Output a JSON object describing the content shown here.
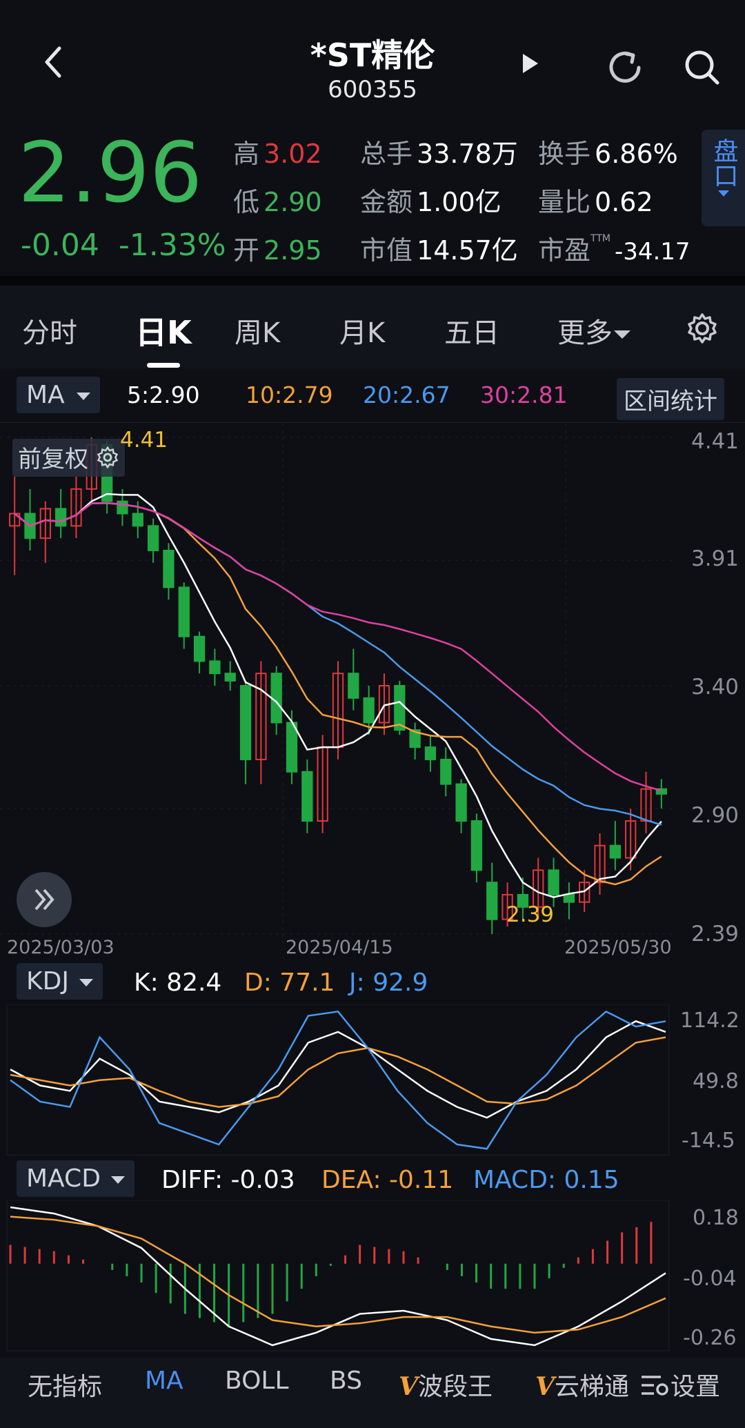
{
  "header": {
    "title": "*ST精伦",
    "code": "600355",
    "price": "2.96",
    "change": "-0.04",
    "change_pct": "-1.33%",
    "pankou": "盘口",
    "quote": {
      "high_label": "高",
      "high": "3.02",
      "low_label": "低",
      "low": "2.90",
      "open_label": "开",
      "open": "2.95",
      "volume_label": "总手",
      "volume": "33.78万",
      "amount_label": "金额",
      "amount": "1.00亿",
      "mktcap_label": "市值",
      "mktcap": "14.57亿",
      "turnover_label": "换手",
      "turnover": "6.86%",
      "volratio_label": "量比",
      "volratio": "0.62",
      "pe_label": "市盈",
      "pe_sup": "TTM",
      "pe": "-34.17"
    }
  },
  "tabs": [
    "分时",
    "日K",
    "周K",
    "月K",
    "五日",
    "更多"
  ],
  "active_tab": "日K",
  "ma": {
    "selector": "MA",
    "ma5": "5:2.90",
    "ma10": "10:2.79",
    "ma20": "20:2.67",
    "ma30": "30:2.81",
    "range_stats": "区间统计",
    "colors": {
      "ma5": "#ffffff",
      "ma10": "#f5a03a",
      "ma20": "#4a9af0",
      "ma30": "#e040a0"
    }
  },
  "main_chart": {
    "adjust_label": "前复权",
    "high_marker": "4.41",
    "low_marker": "2.39",
    "y_labels": [
      "4.41",
      "3.91",
      "3.40",
      "2.90",
      "2.39"
    ],
    "dates": [
      "2025/03/03",
      "2025/04/15",
      "2025/05/30"
    ]
  },
  "kdj": {
    "selector": "KDJ",
    "k": "K: 82.4",
    "d": "D: 77.1",
    "j": "J: 92.9",
    "y_labels": [
      "114.2",
      "49.8",
      "-14.5"
    ]
  },
  "macd": {
    "selector": "MACD",
    "diff": "DIFF: -0.03",
    "dea": "DEA: -0.11",
    "macd": "MACD: 0.15",
    "y_labels": [
      "0.18",
      "-0.04",
      "-0.26"
    ]
  },
  "bottom_nav": {
    "items": [
      "无指标",
      "MA",
      "BOLL",
      "BS",
      "波段王",
      "云梯通",
      "设置"
    ],
    "active": "MA",
    "v_mark": "V"
  },
  "chart_data": {
    "type": "candlestick",
    "title": "",
    "x": [
      "2025/03/03",
      "2025/04/15",
      "2025/05/30"
    ],
    "ylim": [
      2.39,
      4.41
    ],
    "candles_ohlc": [
      [
        4.05,
        4.25,
        3.85,
        4.1
      ],
      [
        4.1,
        4.2,
        3.95,
        4.0
      ],
      [
        4.0,
        4.15,
        3.9,
        4.12
      ],
      [
        4.12,
        4.2,
        4.0,
        4.05
      ],
      [
        4.05,
        4.25,
        4.0,
        4.2
      ],
      [
        4.2,
        4.41,
        4.15,
        4.38
      ],
      [
        4.38,
        4.4,
        4.1,
        4.15
      ],
      [
        4.15,
        4.2,
        4.05,
        4.1
      ],
      [
        4.1,
        4.15,
        4.0,
        4.05
      ],
      [
        4.05,
        4.08,
        3.9,
        3.95
      ],
      [
        3.95,
        3.98,
        3.75,
        3.8
      ],
      [
        3.8,
        3.82,
        3.55,
        3.6
      ],
      [
        3.6,
        3.62,
        3.45,
        3.5
      ],
      [
        3.5,
        3.55,
        3.4,
        3.45
      ],
      [
        3.45,
        3.5,
        3.38,
        3.42
      ],
      [
        3.4,
        3.42,
        3.0,
        3.1
      ],
      [
        3.1,
        3.5,
        3.0,
        3.45
      ],
      [
        3.45,
        3.48,
        3.2,
        3.25
      ],
      [
        3.25,
        3.3,
        3.0,
        3.05
      ],
      [
        3.05,
        3.1,
        2.8,
        2.85
      ],
      [
        2.85,
        3.2,
        2.8,
        3.15
      ],
      [
        3.15,
        3.5,
        3.1,
        3.45
      ],
      [
        3.45,
        3.55,
        3.3,
        3.35
      ],
      [
        3.35,
        3.4,
        3.2,
        3.25
      ],
      [
        3.25,
        3.45,
        3.2,
        3.4
      ],
      [
        3.4,
        3.42,
        3.2,
        3.22
      ],
      [
        3.22,
        3.25,
        3.1,
        3.15
      ],
      [
        3.15,
        3.2,
        3.05,
        3.1
      ],
      [
        3.1,
        3.15,
        2.95,
        3.0
      ],
      [
        3.0,
        3.02,
        2.8,
        2.85
      ],
      [
        2.85,
        2.88,
        2.6,
        2.65
      ],
      [
        2.6,
        2.68,
        2.39,
        2.45
      ],
      [
        2.45,
        2.6,
        2.42,
        2.55
      ],
      [
        2.55,
        2.62,
        2.45,
        2.5
      ],
      [
        2.5,
        2.7,
        2.45,
        2.65
      ],
      [
        2.65,
        2.7,
        2.5,
        2.55
      ],
      [
        2.55,
        2.6,
        2.45,
        2.52
      ],
      [
        2.52,
        2.65,
        2.48,
        2.6
      ],
      [
        2.6,
        2.8,
        2.55,
        2.75
      ],
      [
        2.75,
        2.85,
        2.65,
        2.7
      ],
      [
        2.7,
        2.9,
        2.65,
        2.85
      ],
      [
        2.85,
        3.05,
        2.8,
        2.98
      ],
      [
        2.98,
        3.02,
        2.9,
        2.96
      ]
    ],
    "kdj_series": {
      "K": [
        60,
        45,
        40,
        70,
        55,
        30,
        25,
        20,
        30,
        45,
        85,
        95,
        80,
        60,
        40,
        25,
        15,
        30,
        40,
        60,
        90,
        105,
        95
      ],
      "D": [
        55,
        50,
        45,
        50,
        52,
        40,
        30,
        25,
        28,
        35,
        60,
        75,
        80,
        72,
        60,
        45,
        30,
        28,
        32,
        45,
        65,
        85,
        90
      ],
      "J": [
        50,
        30,
        25,
        90,
        60,
        10,
        0,
        -10,
        25,
        60,
        110,
        114,
        80,
        40,
        10,
        -10,
        -14,
        30,
        55,
        90,
        114,
        100,
        105
      ]
    },
    "macd_series": {
      "DIFF": [
        0.18,
        0.16,
        0.12,
        0.05,
        -0.08,
        -0.2,
        -0.26,
        -0.22,
        -0.16,
        -0.15,
        -0.18,
        -0.24,
        -0.26,
        -0.2,
        -0.12,
        -0.03
      ],
      "DEA": [
        0.15,
        0.14,
        0.12,
        0.08,
        0.0,
        -0.1,
        -0.18,
        -0.2,
        -0.19,
        -0.17,
        -0.17,
        -0.2,
        -0.22,
        -0.21,
        -0.17,
        -0.11
      ],
      "MACD": [
        0.06,
        0.04,
        0.0,
        -0.06,
        -0.16,
        -0.2,
        -0.16,
        -0.04,
        0.06,
        0.04,
        -0.02,
        -0.08,
        -0.08,
        0.02,
        0.1,
        0.15
      ]
    }
  }
}
